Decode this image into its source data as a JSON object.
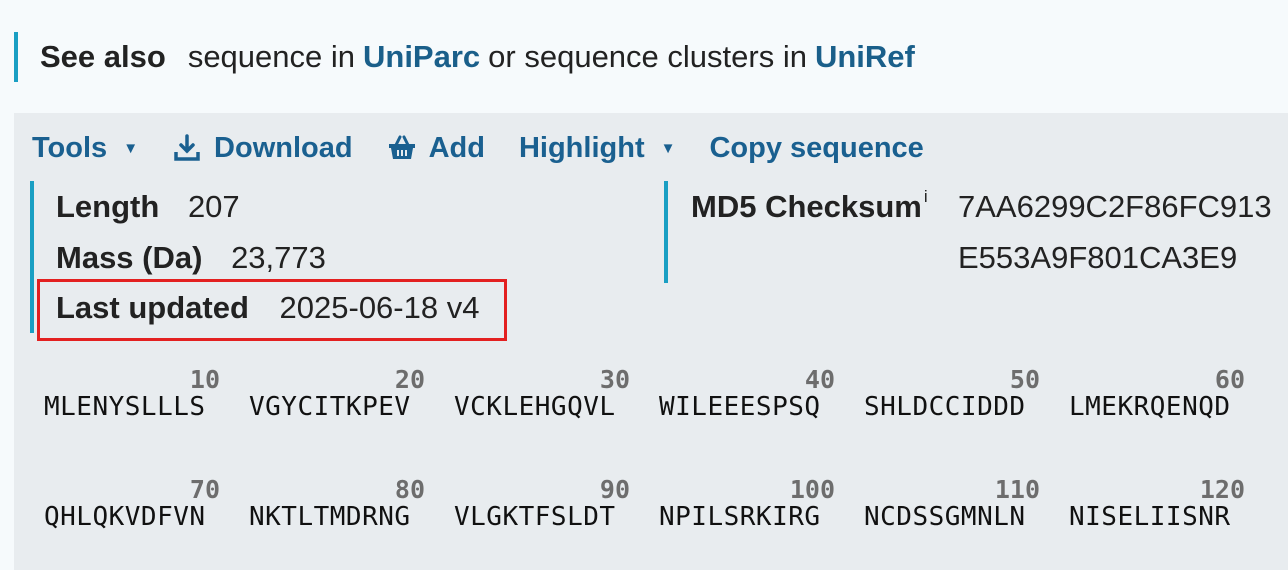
{
  "see_also": {
    "label": "See also",
    "text1": "sequence in",
    "link1": "UniParc",
    "text2": "or sequence clusters in",
    "link2": "UniRef"
  },
  "toolbar": {
    "tools": "Tools",
    "download": "Download",
    "add": "Add",
    "highlight": "Highlight",
    "copy": "Copy sequence"
  },
  "info": {
    "length_label": "Length",
    "length_value": "207",
    "mass_label": "Mass (Da)",
    "mass_value": "23,773",
    "updated_label": "Last updated",
    "updated_value": "2025-06-18 v4",
    "md5_label": "MD5 Checksum",
    "md5_info": "i",
    "md5_line1": "7AA6299C2F86FC913",
    "md5_line2": "E553A9F801CA3E9"
  },
  "sequence": [
    {
      "num": "10",
      "seq": "MLENYSLLLS"
    },
    {
      "num": "20",
      "seq": "VGYCITKPEV"
    },
    {
      "num": "30",
      "seq": "VCKLEHGQVL"
    },
    {
      "num": "40",
      "seq": "WILEEESPSQ"
    },
    {
      "num": "50",
      "seq": "SHLDCCIDDD"
    },
    {
      "num": "60",
      "seq": "LMEKRQENQD"
    },
    {
      "num": "70",
      "seq": "QHLQKVDFVN"
    },
    {
      "num": "80",
      "seq": "NKTLTMDRNG"
    },
    {
      "num": "90",
      "seq": "VLGKTFSLDT"
    },
    {
      "num": "100",
      "seq": "NPILSRKIRG"
    },
    {
      "num": "110",
      "seq": "NCDSSGMNLN"
    },
    {
      "num": "120",
      "seq": "NISELIISNR"
    }
  ],
  "colors": {
    "accent": "#1a9fc3",
    "link": "#1a6090",
    "highlight_border": "#e32020",
    "panel_bg": "#e8ecef"
  }
}
